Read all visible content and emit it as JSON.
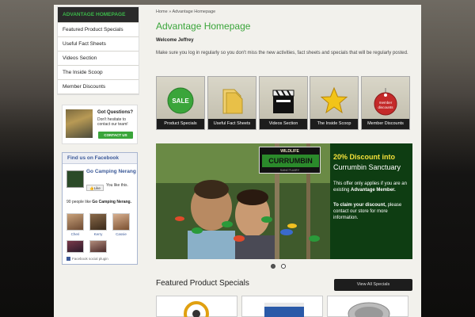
{
  "sidebar": {
    "items": [
      {
        "label": "ADVANTAGE HOMEPAGE"
      },
      {
        "label": "Featured Product Specials"
      },
      {
        "label": "Useful Fact Sheets"
      },
      {
        "label": "Videos Section"
      },
      {
        "label": "The Inside Scoop"
      },
      {
        "label": "Member Discounts"
      }
    ]
  },
  "questions": {
    "title": "Got Questions?",
    "text": "Don't hesitate to contact our team!",
    "button": "CONTACT US"
  },
  "facebook": {
    "header": "Find us on Facebook",
    "page_name": "Go Camping Nerang",
    "like_button": "Like",
    "you_like": "You like this.",
    "count_text": "90 people like",
    "count_name": "Go Camping Nerang.",
    "faces": [
      "Cheri",
      "Kerry",
      "Cassie"
    ],
    "plugin": "Facebook social plugin"
  },
  "main": {
    "breadcrumb": "Home  »  Advantage Homepage",
    "title": "Advantage Homepage",
    "welcome": "Welcome Jeffrey",
    "intro": "Make sure you log in regularly so you don't miss the new activities, fact sheets and specials that will be regularly posted."
  },
  "tiles": [
    {
      "label": "Product Specials",
      "icon": "sale-badge-icon",
      "badge": "SALE"
    },
    {
      "label": "Useful Fact Sheets",
      "icon": "folder-icon"
    },
    {
      "label": "Videos Section",
      "icon": "clapperboard-icon"
    },
    {
      "label": "The Inside Scoop",
      "icon": "star-icon"
    },
    {
      "label": "Member Discounts",
      "icon": "tag-icon",
      "badge": "member discounts"
    }
  ],
  "banner": {
    "logo_top": "WILDLIFE",
    "logo_main": "CURRUMBIN",
    "logo_bottom": "SANCTUARY",
    "logo_sub": "GOLD COAST • AUSTRALIA",
    "heading": "20% Discount into",
    "heading2": "Currumbin Sanctuary",
    "p1_a": "This offer only applies if you are an existing ",
    "p1_b": "Advantage Member.",
    "p2_a": "To claim your discount,",
    "p2_b": " please contact our store for more information."
  },
  "featured": {
    "title": "Featured Product Specials",
    "view_all": "View All Specials"
  },
  "colors": {
    "accent_green": "#3aa53a",
    "banner_yellow": "#f5e23a",
    "facebook_blue": "#3b5998"
  }
}
